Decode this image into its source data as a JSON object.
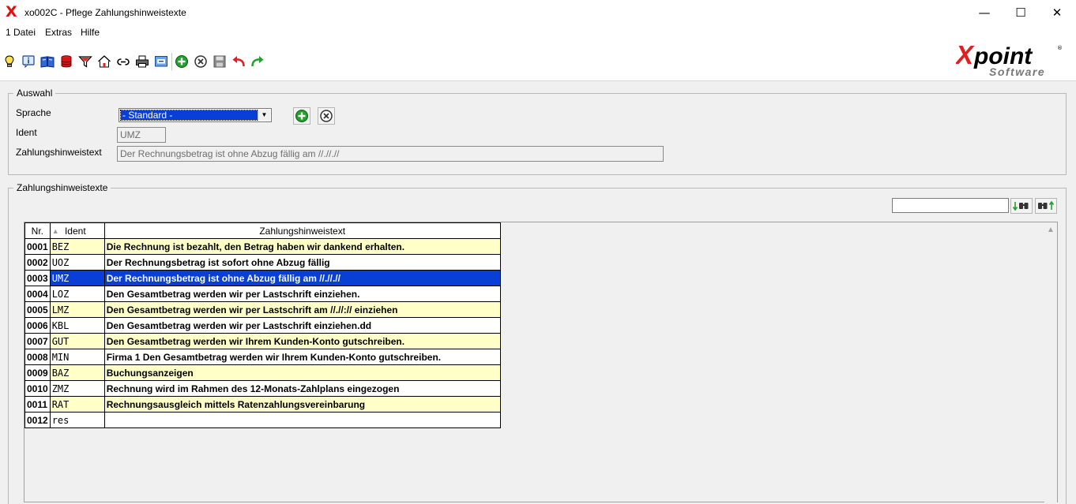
{
  "window": {
    "title": "xo002C - Pflege Zahlungshinweistexte",
    "minimize": "—",
    "maximize": "☐",
    "close": "✕"
  },
  "menu": {
    "items": [
      "1 Datei",
      "Extras",
      "Hilfe"
    ]
  },
  "toolbar": {
    "icons": [
      "lightbulb-icon",
      "info-icon",
      "book-icon",
      "database-icon",
      "filter-icon",
      "home-icon",
      "link-icon",
      "print-icon",
      "screen-icon",
      "add-icon",
      "cancel-icon",
      "save-icon",
      "undo-icon",
      "redo-icon"
    ]
  },
  "logo": {
    "main": "Xpoint",
    "sub": "Software",
    "registered": "®"
  },
  "auswahl": {
    "legend": "Auswahl",
    "sprache_label": "Sprache",
    "sprache_value": "- Standard -",
    "ident_label": "Ident",
    "ident_value": "UMZ",
    "text_label": "Zahlungshinweistext",
    "text_value": "Der Rechnungsbetrag ist ohne Abzug fällig am //.//.//"
  },
  "list": {
    "legend": "Zahlungshinweistexte",
    "search_value": "",
    "columns": {
      "nr": "Nr.",
      "ident": "Ident",
      "text": "Zahlungshinweistext"
    },
    "rows": [
      {
        "nr": "0001",
        "ident": "BEZ",
        "text": "Die Rechnung ist bezahlt, den Betrag haben wir dankend erhalten.",
        "style": "yellow"
      },
      {
        "nr": "0002",
        "ident": "UOZ",
        "text": "Der Rechnungsbetrag ist sofort ohne Abzug fällig",
        "style": "white"
      },
      {
        "nr": "0003",
        "ident": "UMZ",
        "text": "Der Rechnungsbetrag ist ohne Abzug fällig am //.//.//",
        "style": "selected"
      },
      {
        "nr": "0004",
        "ident": "LOZ",
        "text": "Den Gesamtbetrag werden wir per Lastschrift einziehen.",
        "style": "white"
      },
      {
        "nr": "0005",
        "ident": "LMZ",
        "text": "Den Gesamtbetrag werden wir per Lastschrift am //.//:// einziehen",
        "style": "yellow"
      },
      {
        "nr": "0006",
        "ident": "KBL",
        "text": "Den Gesamtbetrag werden wir per Lastschrift einziehen.dd",
        "style": "white"
      },
      {
        "nr": "0007",
        "ident": "GUT",
        "text": "Den Gesamtbetrag werden wir Ihrem Kunden-Konto gutschreiben.",
        "style": "yellow"
      },
      {
        "nr": "0008",
        "ident": "MIN",
        "text": "Firma 1 Den Gesamtbetrag werden wir Ihrem Kunden-Konto gutschreiben.",
        "style": "white"
      },
      {
        "nr": "0009",
        "ident": "BAZ",
        "text": "Buchungsanzeigen",
        "style": "yellow"
      },
      {
        "nr": "0010",
        "ident": "ZMZ",
        "text": "Rechnung wird im Rahmen des 12-Monats-Zahlplans eingezogen",
        "style": "white"
      },
      {
        "nr": "0011",
        "ident": "RAT",
        "text": "Rechnungsausgleich mittels Ratenzahlungsvereinbarung",
        "style": "yellow"
      },
      {
        "nr": "0012",
        "ident": "res",
        "text": "",
        "style": "white"
      }
    ]
  }
}
